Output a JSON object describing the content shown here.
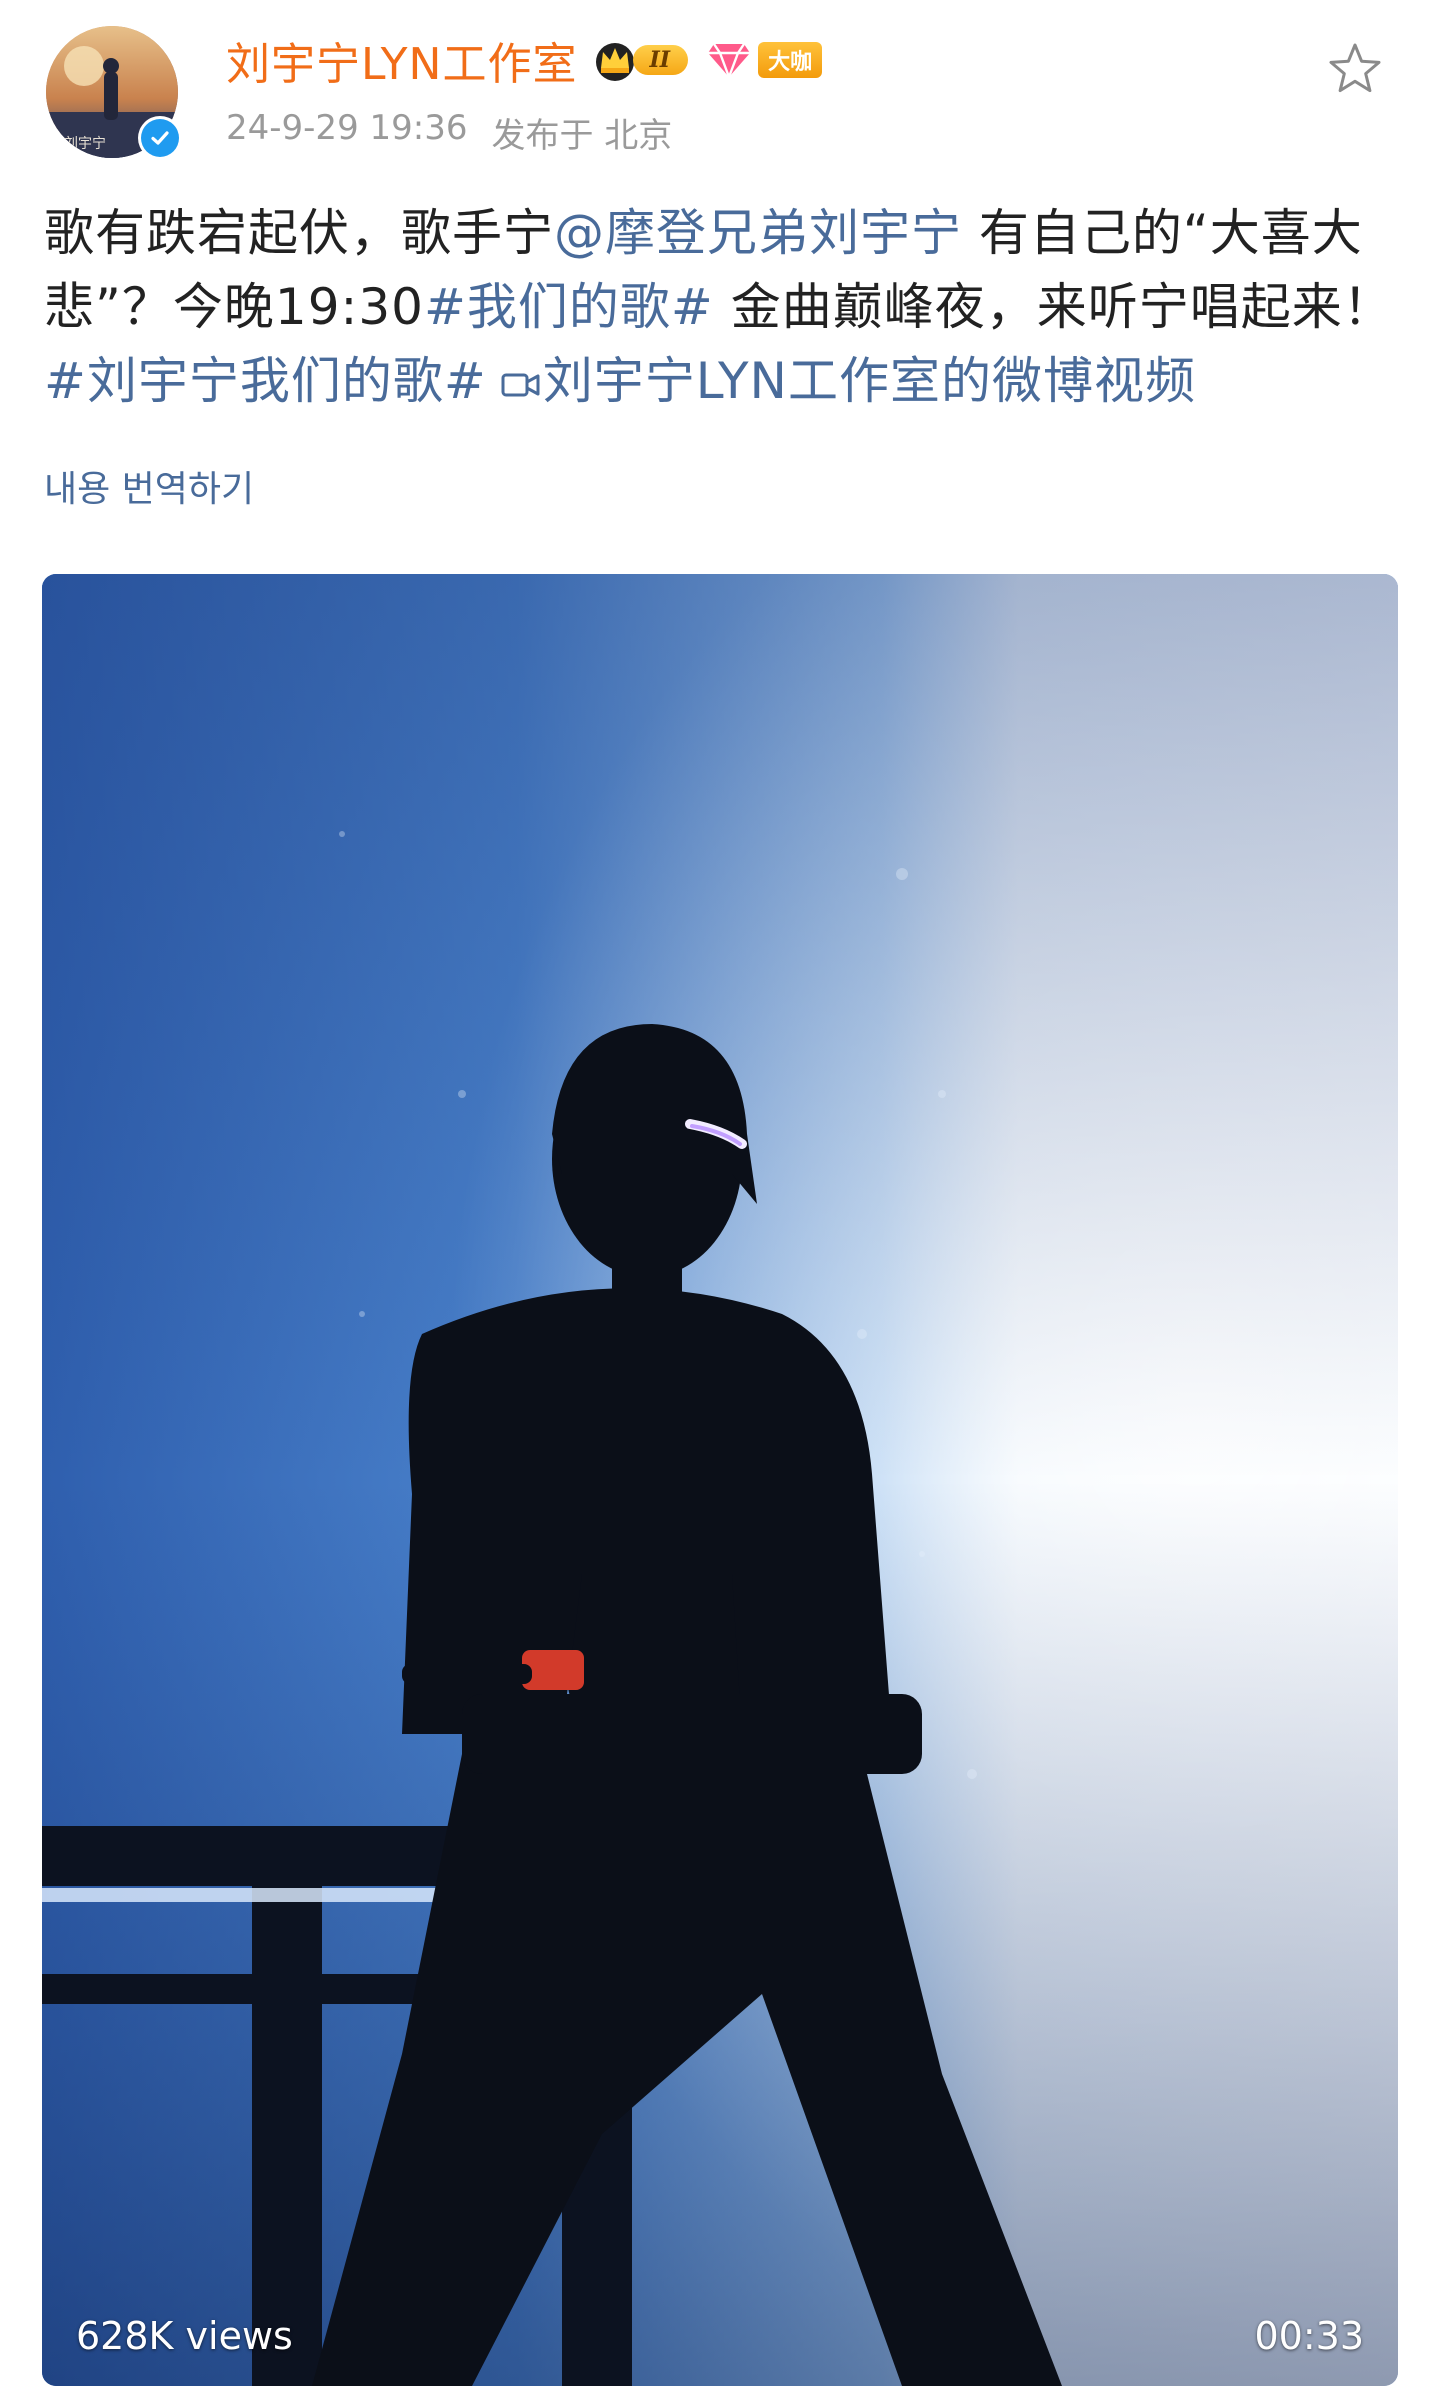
{
  "header": {
    "author_name": "刘宇宁LYN工作室",
    "member_level": "II",
    "vip_label": "大咖",
    "timestamp": "24-9-29 19:36",
    "location": "发布于 北京",
    "avatar_caption": "刘宇宁"
  },
  "post": {
    "text_1": "歌有跌宕起伏，歌手宁",
    "mention": "@摩登兄弟刘宇宁",
    "text_2": " 有自己的“大喜大悲”？今晚19:30",
    "topic_1": "#我们的歌#",
    "text_3": " 金曲巅峰夜，来听宁唱起来！",
    "topic_2": "#刘宇宁我们的歌#",
    "video_link": "刘宇宁LYN工作室的微博视频"
  },
  "translate_label": "내용 번역하기",
  "video": {
    "views": "628K views",
    "duration": "00:33"
  },
  "colors": {
    "author_name": "#f16d18",
    "link": "#496b9a",
    "meta": "#9a9a9a",
    "verified": "#1f9bf0"
  },
  "icons": {
    "verified": "verified-check-icon",
    "crown": "crown-icon",
    "fan": "diamond-fan-icon",
    "star": "star-outline-icon",
    "video_link": "video-camera-icon"
  }
}
